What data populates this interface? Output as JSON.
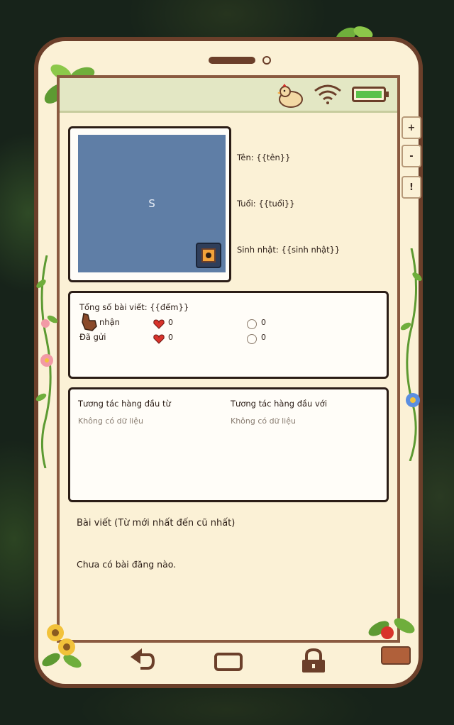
{
  "profile": {
    "avatar_letter": "S",
    "name_label": "Tên: {{tên}}",
    "age_label": "Tuổi: {{tuổi}}",
    "birthday_label": "Sinh nhật: {{sinh nhật}}"
  },
  "side_buttons": {
    "zoom_in": "+",
    "zoom_out": "-",
    "info": "!"
  },
  "stats": {
    "total_posts_label": "Tổng số bài viết: {{đếm}}",
    "received_label": "nhận",
    "sent_label": "Đã gửi",
    "received_likes": "0",
    "received_comments": "0",
    "sent_likes": "0",
    "sent_comments": "0"
  },
  "interactions": {
    "top_from_label": "Tương tác hàng đầu từ",
    "top_with_label": "Tương tác hàng đầu với",
    "top_from_empty": "Không có dữ liệu",
    "top_with_empty": "Không có dữ liệu"
  },
  "posts": {
    "title": "Bài viết (Từ mới nhất đến cũ nhất)",
    "empty": "Chưa có bài đăng nào."
  },
  "colors": {
    "frame": "#6b3f2a",
    "screen_bg": "#fbf1d6",
    "status_bar": "#e3e7c4",
    "avatar_bg": "#5f7ea6",
    "battery": "#5cc24a",
    "heart": "#d8332b"
  },
  "icons": {
    "back": "back-arrow-icon",
    "home": "home-square-icon",
    "lock": "lock-icon",
    "camera": "camera-icon",
    "wifi": "wifi-icon",
    "battery": "battery-icon",
    "chicken": "chicken-icon"
  }
}
